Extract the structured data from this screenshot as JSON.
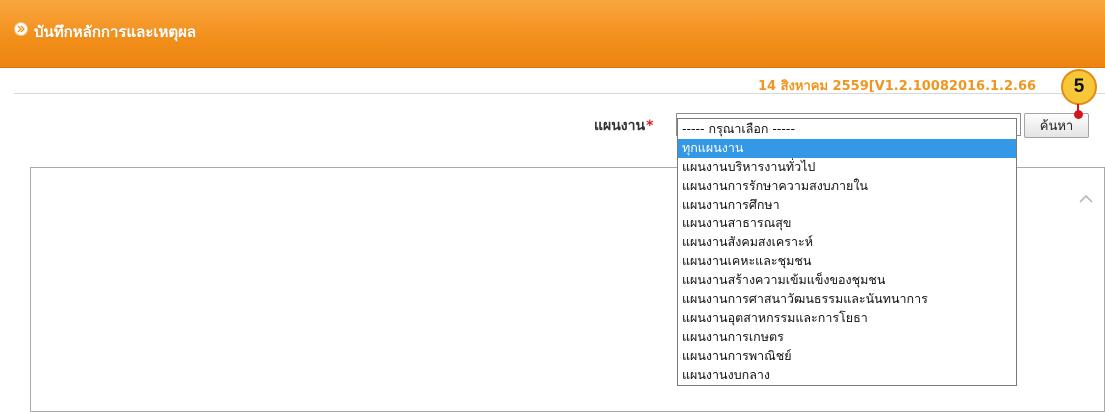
{
  "header": {
    "title": "บันทึกหลักการและเหตุผล",
    "title_icon": "chevron-right-circle-icon"
  },
  "version_text": "14 สิงหาคม 2559[V1.2.10082016.1.2.66",
  "form": {
    "field_label": "แผนงาน",
    "required_mark": "*",
    "search_button": "ค้นหา",
    "textarea_value": ""
  },
  "dropdown": {
    "options": [
      "----- กรุณาเลือก -----",
      "ทุกแผนงาน",
      "แผนงานบริหารงานทั่วไป",
      "แผนงานการรักษาความสงบภายใน",
      "แผนงานการศึกษา",
      "แผนงานสาธารณสุข",
      "แผนงานสังคมสงเคราะห์",
      "แผนงานเคหะและชุมชน",
      "แผนงานสร้างความเข้มแข็งของชุมชน",
      "แผนงานการศาสนาวัฒนธรรมและนันทนาการ",
      "แผนงานอุตสาหกรรมและการโยธา",
      "แผนงานการเกษตร",
      "แผนงานการพาณิชย์",
      "แผนงานงบกลาง"
    ],
    "highlighted": "ทุกแผนงาน"
  },
  "annotation": {
    "badge_number": "5"
  },
  "colors": {
    "header_bar": "#f28e1a",
    "version_text": "#f0961f",
    "selection": "#3399e6",
    "required": "#d21f1f",
    "badge": "#f7c73a",
    "marker": "#d2141e"
  }
}
